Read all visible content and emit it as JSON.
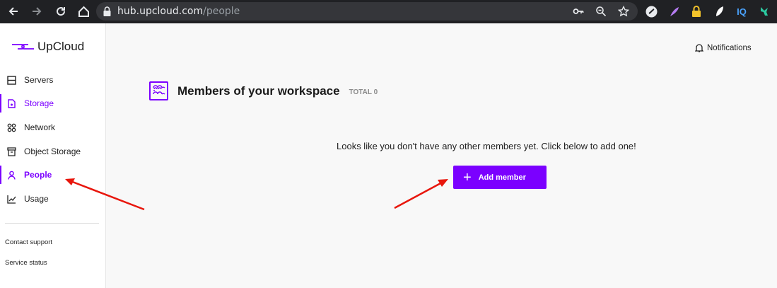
{
  "browser": {
    "url_host": "hub.upcloud.com",
    "url_path": "/people",
    "extensions": [
      "IQ"
    ]
  },
  "app": {
    "logo_text": "UpCloud",
    "notifications_label": "Notifications",
    "accent_color": "#7b00ff"
  },
  "sidebar": {
    "items": [
      {
        "label": "Servers",
        "icon": "server-icon"
      },
      {
        "label": "Storage",
        "icon": "storage-icon"
      },
      {
        "label": "Network",
        "icon": "network-icon"
      },
      {
        "label": "Object Storage",
        "icon": "object-storage-icon"
      },
      {
        "label": "People",
        "icon": "person-icon"
      },
      {
        "label": "Usage",
        "icon": "chart-icon"
      }
    ],
    "footer": {
      "contact_support": "Contact support",
      "service_status": "Service status"
    }
  },
  "main": {
    "title": "Members of your workspace",
    "total": "TOTAL 0",
    "empty_message": "Looks like you don't have any other members yet. Click below to add one!",
    "add_button_label": "Add member"
  }
}
